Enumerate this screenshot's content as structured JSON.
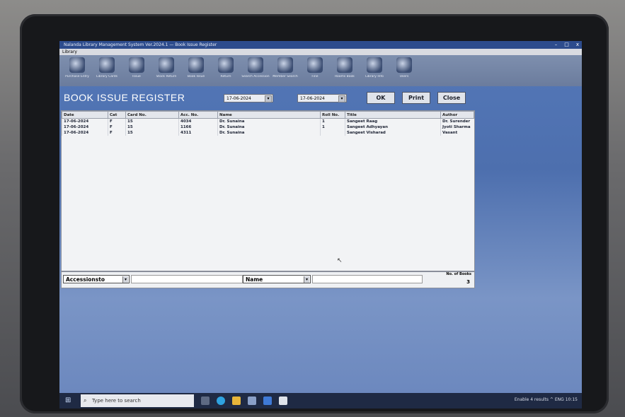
{
  "window": {
    "title": "Nalanda Library Management System Ver.2024.1 — Book Issue Register",
    "minimize": "–",
    "maximize": "□",
    "close": "x"
  },
  "menu": {
    "library": "Library"
  },
  "toolbar": [
    {
      "label": "Purchase Entry"
    },
    {
      "label": "Library Cards"
    },
    {
      "label": "Issue"
    },
    {
      "label": "Stock Return"
    },
    {
      "label": "Book Issue"
    },
    {
      "label": "Return"
    },
    {
      "label": "Search Accession"
    },
    {
      "label": "Member Search"
    },
    {
      "label": "Fine"
    },
    {
      "label": "Rooms Book"
    },
    {
      "label": "Library Info"
    },
    {
      "label": "Users"
    }
  ],
  "header": {
    "title": "BOOK ISSUE REGISTER",
    "from_date": "17-06-2024",
    "to_date": "17-06-2024",
    "ok": "OK",
    "print": "Print",
    "close": "Close"
  },
  "table": {
    "columns": [
      "Date",
      "Cat",
      "Card No.",
      "Acc. No.",
      "Name",
      "Roll No.",
      "Title",
      "Author"
    ],
    "rows": [
      [
        "17-06-2024",
        "F",
        "15",
        "4034",
        "Dr. Sunaina",
        "1",
        "Sangeet Raag",
        "Dr. Surender"
      ],
      [
        "17-06-2024",
        "F",
        "15",
        "1166",
        "Dr. Sunaina",
        "1",
        "Sangeet Adhyayan",
        "Jyoti Sharma"
      ],
      [
        "17-06-2024",
        "F",
        "15",
        "4311",
        "Dr. Sunaina",
        "",
        "Sangeet Visharad",
        "Vasant"
      ]
    ]
  },
  "bottom": {
    "filter1": "Accessionsto",
    "filter2": "Name",
    "count_label": "No. of Books",
    "count_value": "3"
  },
  "taskbar": {
    "search_placeholder": "Type here to search",
    "tray": "Enable 4 results  ^  ENG  10:15"
  }
}
